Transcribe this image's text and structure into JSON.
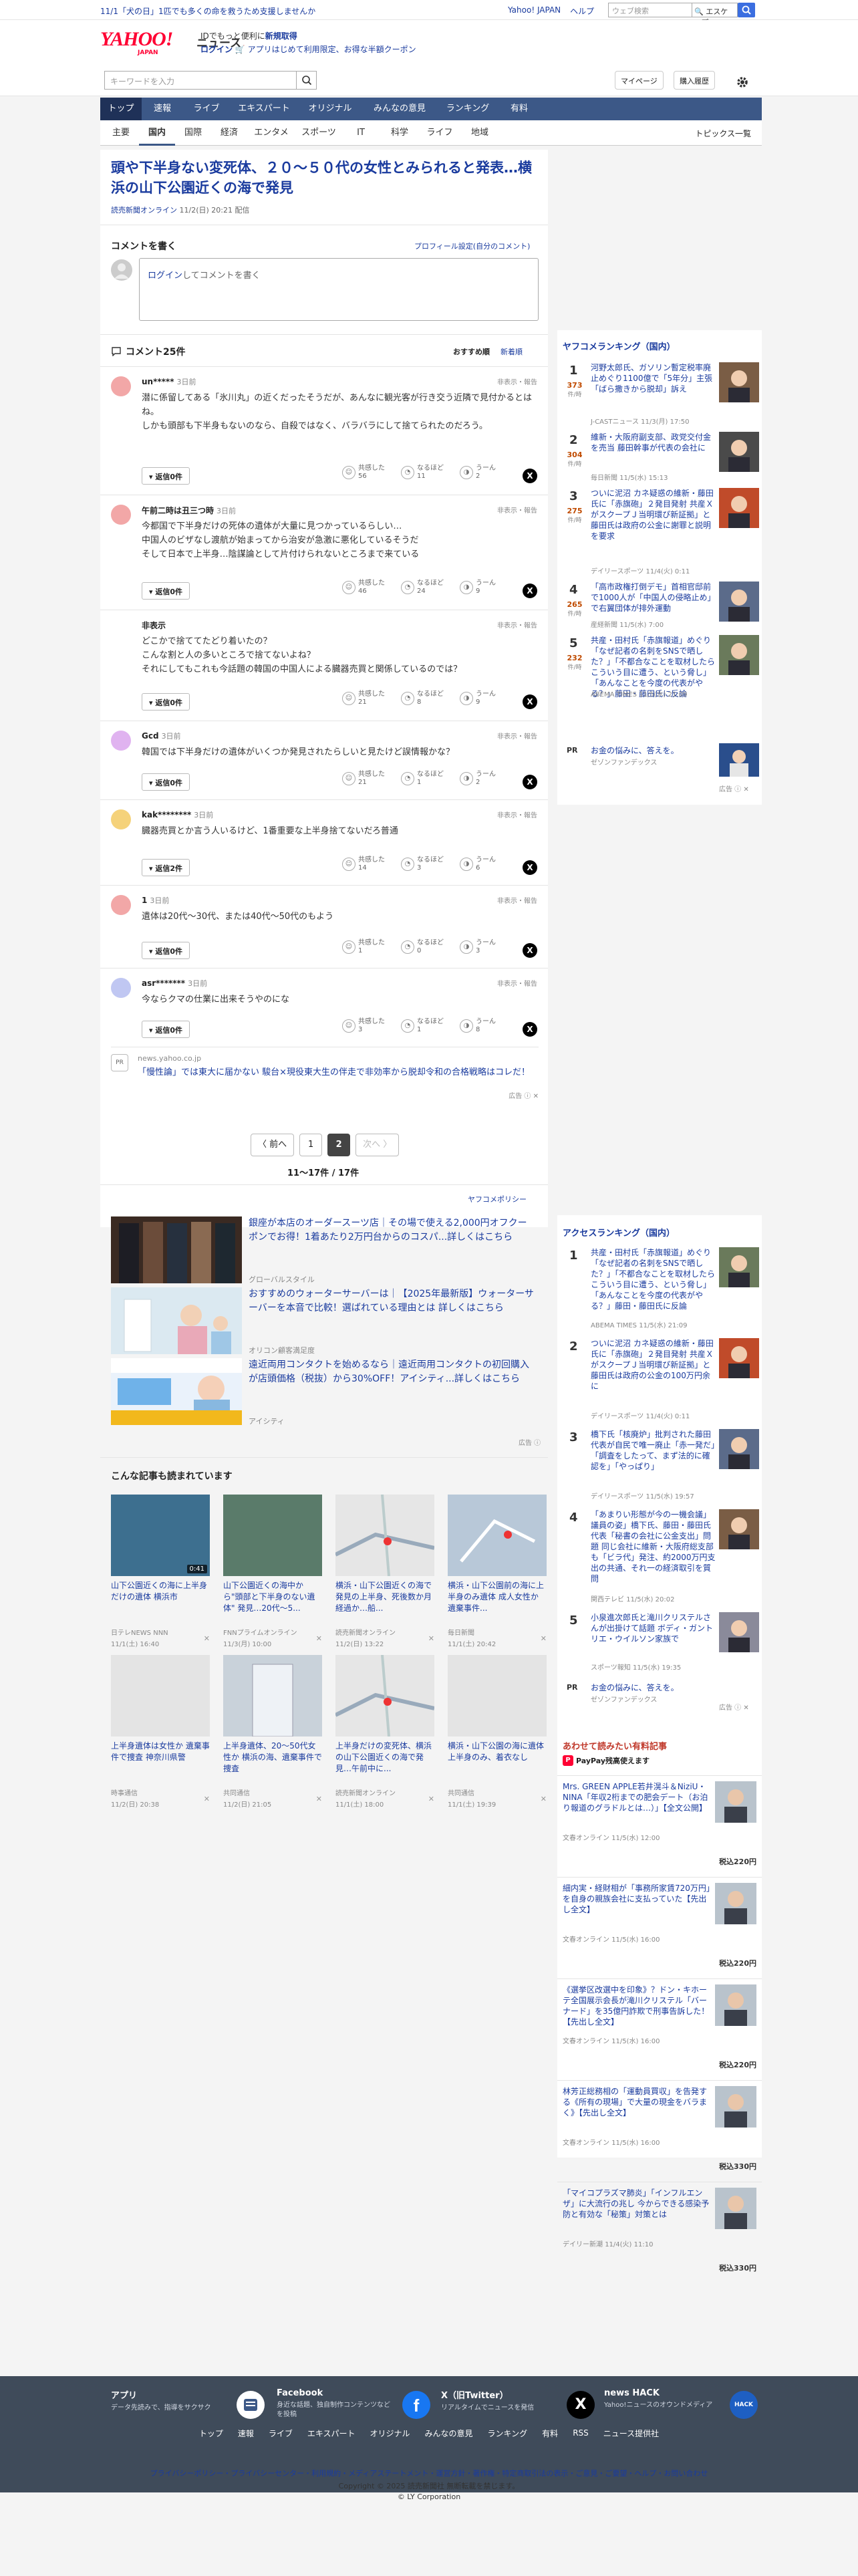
{
  "topbar": {
    "notice": "11/1「犬の日」1匹でも多くの命を救うため支援しませんか",
    "links": [
      "Yahoo! JAPAN",
      "ヘルプ"
    ],
    "search_placeholder": "ウェブ検索",
    "search_toggle": "🔍 エスケープ"
  },
  "header": {
    "logo_text": "YAHOO!",
    "logo_sub": "JAPAN",
    "logo_service": "ニュース",
    "promo_line1_a": "IDでもっと便利に",
    "promo_line1_b": "新規取得",
    "promo_line2_a": "ログイン",
    "promo_line2_b": "🛒 アプリはじめて利用限定、お得な半額クーポン"
  },
  "searchrow": {
    "placeholder": "キーワードを入力",
    "mypage": "マイページ",
    "purchase": "購入履歴"
  },
  "nav_primary": [
    {
      "label": "トップ",
      "active": true
    },
    {
      "label": "速報",
      "active": false
    },
    {
      "label": "ライブ",
      "active": false
    },
    {
      "label": "エキスパート",
      "active": false
    },
    {
      "label": "オリジナル",
      "active": false
    },
    {
      "label": "みんなの意見",
      "active": false
    },
    {
      "label": "ランキング",
      "active": false
    },
    {
      "label": "有料",
      "active": false
    }
  ],
  "nav_secondary": [
    {
      "label": "主要"
    },
    {
      "label": "国内"
    },
    {
      "label": "国際"
    },
    {
      "label": "経済"
    },
    {
      "label": "エンタメ"
    },
    {
      "label": "スポーツ"
    },
    {
      "label": "IT"
    },
    {
      "label": "科学"
    },
    {
      "label": "ライフ"
    },
    {
      "label": "地域"
    }
  ],
  "nav_secondary_more": "トピックス一覧",
  "article": {
    "title": "頭や下半身ない変死体、２０〜５０代の女性とみられると発表…横浜の山下公園近くの海で発見",
    "source": "読売新聞オンライン",
    "date": "11/2(日) 20:21 配信"
  },
  "comment_form": {
    "heading": "コメントを書く",
    "profile_link": "プロフィール設定(自分のコメント)",
    "login": "ログイン",
    "placeholder": "してコメントを書く"
  },
  "comments_header": {
    "title": "コメント25件",
    "sort_recommended": "おすすめ順",
    "sort_newest": "新着順"
  },
  "comments": [
    {
      "user": "un*****",
      "time": "3日前",
      "report": "非表示・報告",
      "text": "潜に係留してある「氷川丸」の近くだったそうだが、あんなに観光客が行き交う近隣で見付かるとはね。\nしかも頭部も下半身もないのなら、自殺ではなく、バラバラにして捨てられたのだろう。",
      "reply": "返信0件",
      "agree": "56",
      "understand": "11",
      "hmm": "2",
      "agree_label": "共感した",
      "understand_label": "なるほど",
      "hmm_label": "うーん",
      "avatar_color": "#f2a7a7"
    },
    {
      "user": "午前二時は丑三つ時",
      "time": "3日前",
      "report": "非表示・報告",
      "text": "今都国で下半身だけの死体の遺体が大量に見つかっているらしい…\n中国人のビザなし渡航が始まってから治安が急激に悪化しているそうだ\nそして日本で上半身…陰謀論として片付けられないところまで来ている",
      "reply": "返信0件",
      "agree": "46",
      "understand": "24",
      "hmm": "9",
      "agree_label": "共感した",
      "understand_label": "なるほど",
      "hmm_label": "うーん",
      "avatar_color": "#f2a7a7"
    },
    {
      "user": "非表示",
      "time": "",
      "report": "非表示・報告",
      "text": "どこかで捨ててたどり着いたの？\nこんな割と人の多いところで捨てないよね？\nそれにしてもこれも今話題の韓国の中国人による臓器売買と関係しているのでは？",
      "reply": "返信0件",
      "agree": "21",
      "understand": "8",
      "hmm": "9",
      "agree_label": "共感した",
      "understand_label": "なるほど",
      "hmm_label": "うーん",
      "avatar_color": ""
    },
    {
      "user": "Gcd",
      "time": "3日前",
      "report": "非表示・報告",
      "text": "韓国では下半身だけの遺体がいくつか発見されたらしいと見たけど誤情報かな？",
      "reply": "返信0件",
      "agree": "21",
      "understand": "1",
      "hmm": "2",
      "agree_label": "共感した",
      "understand_label": "なるほど",
      "hmm_label": "うーん",
      "avatar_color": "#e0b3f0"
    },
    {
      "user": "kak********",
      "time": "3日前",
      "report": "非表示・報告",
      "text": "臓器売買とか言う人いるけど、1番重要な上半身捨てないだろ普通",
      "reply": "返信2件",
      "agree": "14",
      "understand": "3",
      "hmm": "6",
      "agree_label": "共感した",
      "understand_label": "なるほど",
      "hmm_label": "うーん",
      "avatar_color": "#f5d27a"
    },
    {
      "user": "1",
      "time": "3日前",
      "report": "非表示・報告",
      "text": "遺体は20代〜30代、または40代〜50代のもよう",
      "reply": "返信0件",
      "agree": "1",
      "understand": "0",
      "hmm": "3",
      "agree_label": "共感した",
      "understand_label": "なるほど",
      "hmm_label": "うーん",
      "avatar_color": "#f2a7a7"
    },
    {
      "user": "asr*******",
      "time": "3日前",
      "report": "非表示・報告",
      "text": "今ならクマの仕業に出来そうやのにな",
      "reply": "返信0件",
      "agree": "3",
      "understand": "1",
      "hmm": "8",
      "agree_label": "共感した",
      "understand_label": "なるほど",
      "hmm_label": "うーん",
      "avatar_color": "#c0c7f2"
    }
  ],
  "inline_ad": {
    "pr": "PR",
    "domain": "news.yahoo.co.jp",
    "text": "「慢性論」では東大に届かない 駿台×現役東大生の伴走で非効率から脱却令和の合格戦略はコレだ！",
    "label": "広告 ⓘ ✕"
  },
  "pager": {
    "prev": "〈 前へ",
    "pages": [
      "1",
      "2"
    ],
    "current": "2",
    "next": "次へ 〉",
    "count": "11〜17件 / 17件"
  },
  "policy_link": "ヤフコメポリシー",
  "sponsored": [
    {
      "title": "銀座が本店のオーダースーツ店｜その場で使える2,000円オフクーポンでお得！1着あたり2万円台からのコスパ...詳しくはこちら",
      "sponsor": "グローバルスタイル"
    },
    {
      "title": "おすすめのウォーターサーバーは｜【2025年最新版】ウォーターサーバーを本音で比較！選ばれている理由とは 詳しくはこちら",
      "sponsor": "オリコン顧客満足度"
    },
    {
      "title": "遠近両用コンタクトを始めるなら｜遠近両用コンタクトの初回購入が店頭価格（税抜）から30%OFF！アイシティ...詳しくはこちら",
      "sponsor": "アイシティ"
    }
  ],
  "sponsored_label": "広告 ⓘ",
  "recommended": {
    "heading": "こんな記事も読まれています",
    "items": [
      {
        "title": "山下公園近くの海に上半身だけの遺体 横浜市",
        "source": "日テレNEWS NNN",
        "date": "11/1(土) 16:40",
        "badge": "0:41"
      },
      {
        "title": "山下公園近くの海中から\"頭部と下半身のない遺体\" 発見…20代〜5...",
        "source": "FNNプライムオンライン",
        "date": "11/3(月) 10:00",
        "badge": ""
      },
      {
        "title": "横浜・山下公園近くの海で発見の上半身、死後数か月経過か…船...",
        "source": "読売新聞オンライン",
        "date": "11/2(日) 13:22",
        "badge": ""
      },
      {
        "title": "横浜・山下公園前の海に上半身のみ遺体 成人女性か 遺棄事件...",
        "source": "毎日新聞",
        "date": "11/1(土) 20:42",
        "badge": ""
      },
      {
        "title": "上半身遺体は女性か 遺棄事件で捜査 神奈川県警",
        "source": "時事通信",
        "date": "11/2(日) 20:38",
        "badge": ""
      },
      {
        "title": "上半身遺体、20〜50代女性か 横浜の海、遺棄事件で捜査",
        "source": "共同通信",
        "date": "11/2(日) 21:05",
        "badge": ""
      },
      {
        "title": "上半身だけの変死体、横浜の山下公園近くの海で発見…午前中に...",
        "source": "読売新聞オンライン",
        "date": "11/1(土) 18:00",
        "badge": ""
      },
      {
        "title": "横浜・山下公園の海に遺体 上半身のみ、着衣なし",
        "source": "共同通信",
        "date": "11/1(土) 19:39",
        "badge": ""
      }
    ]
  },
  "yahcom_ranking": {
    "heading": "ヤフコメランキング（国内）",
    "unit": "件/時",
    "items": [
      {
        "rank": "1",
        "count": "373",
        "title": "河野太郎氏、ガソリン暫定税率廃止めぐり1100億で「5年分」主張「ばら撒きから脱却」訴え",
        "source": "J-CASTニュース",
        "date": "11/3(月) 17:50"
      },
      {
        "rank": "2",
        "count": "304",
        "title": "維新・大阪府副支部、政党交付金を売当 藤田幹事が代表の会社に",
        "source": "毎日新聞",
        "date": "11/5(水) 15:13"
      },
      {
        "rank": "3",
        "count": "275",
        "title": "ついに泥沼 カネ疑惑の維新・藤田氏に「赤旗砲」２発目発射 共産ＸがスクープＪ当明環ぴ新証拠」と 藤田氏は政府の公金に謝罪と説明を要求",
        "source": "デイリースポーツ",
        "date": "11/4(火) 0:11"
      },
      {
        "rank": "4",
        "count": "265",
        "title": "「高市政権打倒デモ」首相官邸前で1000人が「中国人の侵略止め」で右翼団体が排外運動",
        "source": "産経新聞",
        "date": "11/5(水) 7:00"
      },
      {
        "rank": "5",
        "count": "232",
        "title": "共産・田村氏「赤旗報道」めぐり「なぜ記者の名刺をSNSで晒した？」「不都合なことを取材したらこういう目に遭う、という脅し」「あんなことを今度の代表がやる？」藤田・藤田氏に反論",
        "source": "ABEMA TIMES",
        "date": "11/5(水) 21:09"
      }
    ]
  },
  "right_pr_1": {
    "pr": "PR",
    "title": "お金の悩みに、答えを。",
    "source": "ゼゾンファンデックス",
    "label": "広告 ⓘ ✕"
  },
  "access_ranking": {
    "heading": "アクセスランキング（国内）",
    "items": [
      {
        "rank": "1",
        "title": "共産・田村氏「赤旗報道」めぐり「なぜ記者の名刺をSNSで晒した？」「不都合なことを取材したらこういう目に遭う、という脅し」「あんなことを今度の代表がやる？」藤田・藤田氏に反論",
        "source": "ABEMA TIMES",
        "date": "11/5(水) 21:09"
      },
      {
        "rank": "2",
        "title": "ついに泥沼 カネ疑惑の維新・藤田氏に「赤旗砲」２発目発射 共産ＸがスクープＪ当明環ぴ新証拠」と 藤田氏は政府の公金の100万円余に",
        "source": "デイリースポーツ",
        "date": "11/4(火) 0:11"
      },
      {
        "rank": "3",
        "title": "橋下氏「核廃炉」批判された藤田代表が自民で唯一廃止「赤一発だ」「調査をしたって、まず法的に確認を」「やっぱり」",
        "source": "デイリースポーツ",
        "date": "11/5(水) 19:57"
      },
      {
        "rank": "4",
        "title": "「あまりい形態が今の一機会議」議員の姿」橋下氏、藤田・藤田氏代表「秘書の会社に公金支出」問題 同じ会社に維新・大阪府総支部も「ビラ代」発注、約2000万円支出の共通、それ一の経済取引を質問",
        "source": "関西テレビ",
        "date": "11/5(水) 20:02"
      },
      {
        "rank": "5",
        "title": "小泉進次郎氏と滝川クリステルさんが出掛けて話題 ボディ・ガントリエ・ウイルソン家族で",
        "source": "スポーツ報知",
        "date": "11/5(水) 19:35"
      }
    ]
  },
  "right_pr_2": {
    "pr": "PR",
    "title": "お金の悩みに、答えを。",
    "source": "ゼゾンファンデックス",
    "label": "広告 ⓘ ✕"
  },
  "paid": {
    "heading": "あわせて読みたい有料記事",
    "badge": "PayPay残高使えます",
    "items": [
      {
        "title": "Mrs. GREEN APPLE若井滉斗＆NiziU・NINA「年収2桁までの肥会デート（お泊り報道のグラドルとは…）」【全文公開】",
        "source": "文春オンライン",
        "date": "11/5(水) 12:00",
        "price": "税込220円"
      },
      {
        "title": "細内実・経財相が「事務所家賃720万円」を自身の親族会社に支払っていた【先出し全文】",
        "source": "文春オンライン",
        "date": "11/5(水) 16:00",
        "price": "税込220円"
      },
      {
        "title": "《選挙区改選中を印象》？ドン・キホーテ全国展示会長が滝川クリステル「バーナード」を35億円詐欺で刑事告訴した！【先出し全文】",
        "source": "文春オンライン",
        "date": "11/5(水) 16:00",
        "price": "税込220円"
      },
      {
        "title": "林芳正総務相の「運動員買収」を告発する《所有の現場」で大量の現金をバラまく》【先出し全文】",
        "source": "文春オンライン",
        "date": "11/5(水) 16:00",
        "price": "税込330円"
      },
      {
        "title": "「マイコプラズマ肺炎」「インフルエンザ」に大流行の兆し 今からできる感染予防と有効な「秘策」対策とは",
        "source": "デイリー新潮",
        "date": "11/4(火) 11:10",
        "price": "税込330円"
      }
    ]
  },
  "footer": {
    "apps": [
      {
        "name": "アプリ",
        "desc": "データ先読みで、指導をサクサク"
      },
      {
        "name": "Facebook",
        "desc": "身近な話題、独自制作コンテンツなどを投稿"
      },
      {
        "name": "X（旧Twitter）",
        "desc": "リアルタイムでニュースを発信"
      },
      {
        "name": "news HACK",
        "desc": "Yahoo!ニュースのオウンドメディア"
      }
    ],
    "nav": [
      "トップ",
      "速報",
      "ライブ",
      "エキスパート",
      "オリジナル",
      "みんなの意見",
      "ランキング",
      "有料",
      "RSS",
      "ニュース提供社"
    ],
    "links": "プライバシーポリシー・プライバシーセンター・利用規約・メディアステートメント・運営方針・著作権・特定商取引法の表示・ご意見・ご要望・ヘルプ・お問い合わせ",
    "copyright1": "Copyright © 2025 読売新聞社 無断転載を禁じます。",
    "copyright2": "© LY Corporation"
  }
}
